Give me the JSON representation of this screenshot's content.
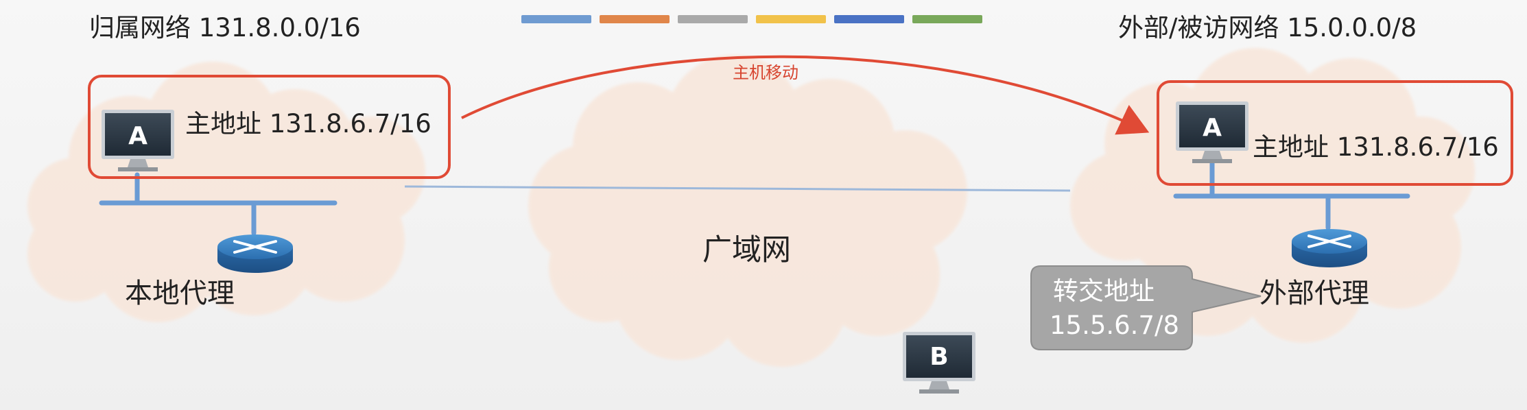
{
  "home_network": {
    "title": "归属网络 131.8.0.0/16",
    "host_letter": "A",
    "host_address": "主地址 131.8.6.7/16",
    "agent_label": "本地代理"
  },
  "foreign_network": {
    "title": "外部/被访网络 15.0.0.0/8",
    "host_letter": "A",
    "host_address": "主地址 131.8.6.7/16",
    "agent_label": "外部代理"
  },
  "wan": {
    "label": "广域网"
  },
  "move_label": "主机移动",
  "care_of_address": {
    "line1": "转交地址",
    "line2": "15.5.6.7/8"
  },
  "correspondent_host": {
    "letter": "B"
  },
  "palette": [
    "#6f9bd1",
    "#e0864a",
    "#a9a9a9",
    "#f1c24a",
    "#4a72c4",
    "#79a85a"
  ],
  "colors": {
    "highlight_red": "#e04a35",
    "cloud_fill": "#f8e6da",
    "link_blue": "#6a9bd4",
    "callout_gray": "#a6a6a6"
  }
}
